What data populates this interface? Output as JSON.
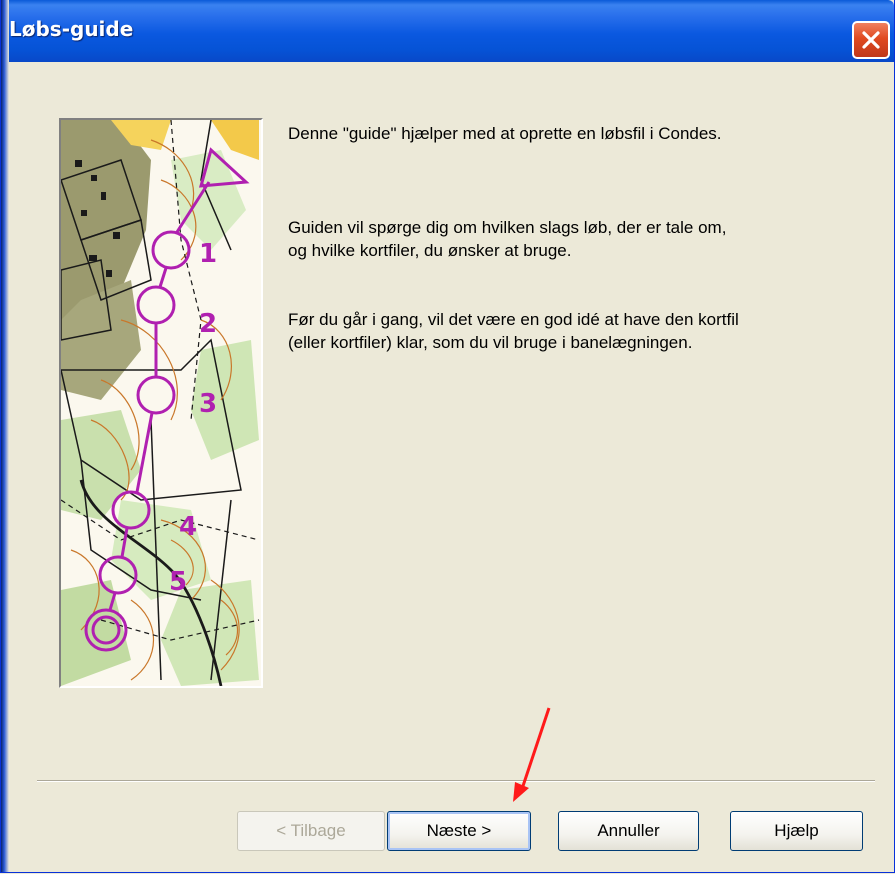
{
  "window": {
    "title": "Løbs-guide",
    "close_icon": "close-icon"
  },
  "intro": {
    "line1": "Denne \"guide\" hjælper med at oprette en løbsfil i Condes.",
    "line2a": "Guiden vil spørge dig om hvilken slags løb, der er tale om,",
    "line2b": "og hvilke kortfiler, du ønsker at bruge.",
    "line3a": "Før du går i gang, vil det være en god idé at have den kortfil",
    "line3b": "(eller kortfiler) klar, som du vil bruge i banelægningen."
  },
  "map_image": {
    "control_numbers": [
      "1",
      "2",
      "3",
      "4",
      "5"
    ],
    "course_color": "#b020b0"
  },
  "buttons": {
    "back": "< Tilbage",
    "next": "Næste >",
    "cancel": "Annuller",
    "help": "Hjælp"
  },
  "annotation": {
    "arrow_color": "#ff1a1a"
  },
  "colors": {
    "titlebar": "#0a58e0",
    "dialog_bg": "#ece9d8",
    "close_button": "#e04a20"
  }
}
